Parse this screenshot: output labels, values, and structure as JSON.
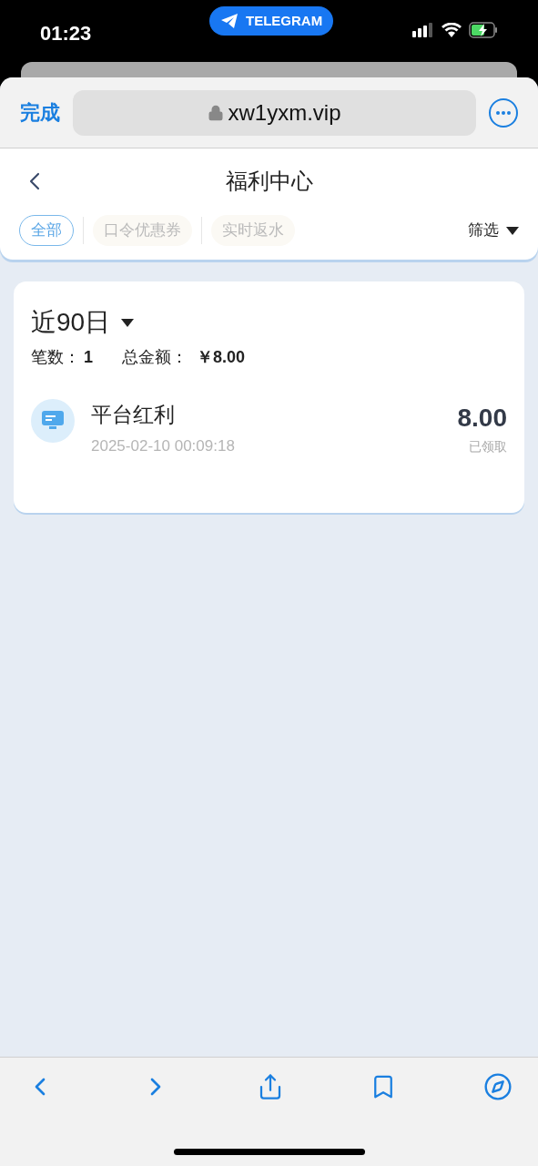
{
  "status_bar": {
    "time": "01:23",
    "app_pill": "TELEGRAM"
  },
  "browser": {
    "done": "完成",
    "url": "xw1yxm.vip"
  },
  "page": {
    "title": "福利中心"
  },
  "tabs": [
    {
      "label": "全部",
      "selected": true
    },
    {
      "label": "口令优惠券",
      "selected": false
    },
    {
      "label": "实时返水",
      "selected": false
    }
  ],
  "filter": {
    "label": "筛选"
  },
  "summary": {
    "period": "近90日",
    "count_label": "笔数：",
    "count": "1",
    "total_label": "总金额：",
    "total": "￥8.00"
  },
  "records": [
    {
      "title": "平台红利",
      "time": "2025-02-10 00:09:18",
      "amount": "8.00",
      "status": "已领取"
    }
  ]
}
